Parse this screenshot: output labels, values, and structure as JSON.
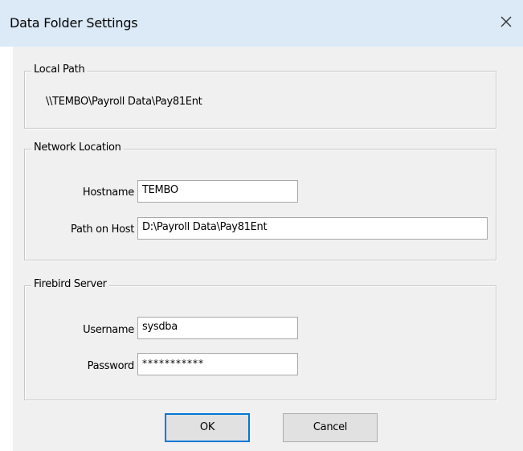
{
  "window": {
    "title": "Data Folder Settings",
    "close_icon": "close-icon"
  },
  "local_path": {
    "legend": "Local Path",
    "value": "\\\\TEMBO\\Payroll Data\\Pay81Ent"
  },
  "network_location": {
    "legend": "Network Location",
    "hostname_label": "Hostname",
    "hostname_value": "TEMBO",
    "path_label": "Path on Host",
    "path_value": "D:\\Payroll Data\\Pay81Ent"
  },
  "firebird_server": {
    "legend": "Firebird Server",
    "username_label": "Username",
    "username_value": "sysdba",
    "password_label": "Password",
    "password_value": "***********"
  },
  "buttons": {
    "ok_label": "OK",
    "cancel_label": "Cancel"
  },
  "colors": {
    "titlebar": "#dceaf8",
    "client": "#f0f0f0",
    "default_button_border": "#0078d7"
  }
}
